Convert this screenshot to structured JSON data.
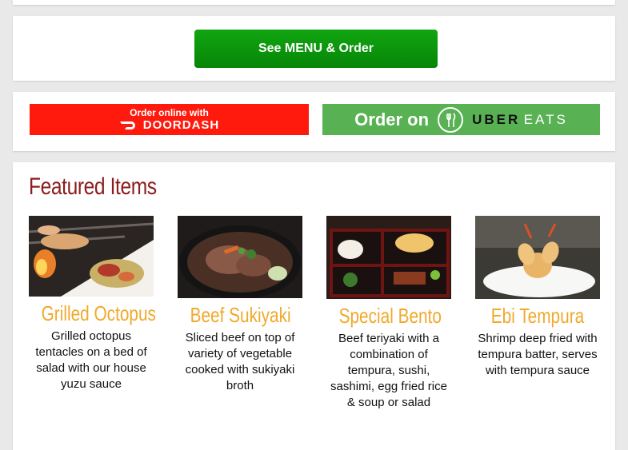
{
  "menu_button": {
    "label": "See MENU & Order"
  },
  "doordash": {
    "prefix": "Order online with",
    "name": "DOORDASH",
    "color": "#ff1a0d"
  },
  "ubereats": {
    "prefix": "Order on",
    "brand_a": "UBER",
    "brand_b": "EATS",
    "color": "#58b153"
  },
  "featured": {
    "title": "Featured Items",
    "items": [
      {
        "name": "Grilled Octopus",
        "description": "Grilled octopus tentacles on a bed of salad with our house yuzu sauce"
      },
      {
        "name": "Beef Sukiyaki",
        "description": "Sliced beef on top of variety of vegetable cooked with sukiyaki broth"
      },
      {
        "name": "Special Bento",
        "description": "Beef teriyaki with a combination of tempura, sushi, sashimi, egg fried rice & soup or salad"
      },
      {
        "name": "Ebi Tempura",
        "description": "Shrimp deep fried with tempura batter, serves with tempura sauce"
      }
    ]
  },
  "colors": {
    "accent_title": "#8b1d1d",
    "item_name": "#f0a92b",
    "button": "#0a950a"
  }
}
